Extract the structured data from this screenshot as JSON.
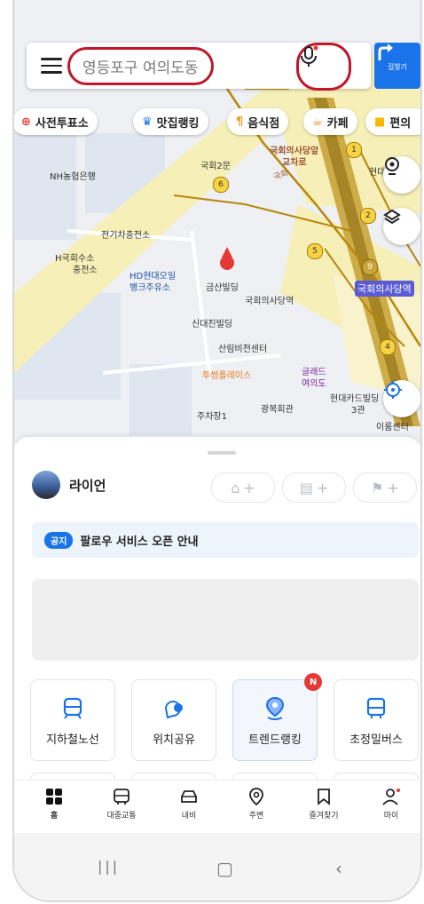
{
  "search": {
    "query": "영등포구 여의도동"
  },
  "directions_label": "길찾기",
  "chips": [
    {
      "icon": "vote-icon",
      "label": "사전투표소"
    },
    {
      "icon": "ranking-icon",
      "label": "맛집랭킹"
    },
    {
      "icon": "fork-icon",
      "label": "음식점"
    },
    {
      "icon": "cafe-icon",
      "label": "카페"
    },
    {
      "icon": "store-icon",
      "label": "편의"
    }
  ],
  "map": {
    "labels": {
      "nh_bank": "NH농협은행",
      "gukhoe_2gate": "국회2문",
      "gukhoe_junction": "국회의사당앞",
      "gyocharo": "교차로",
      "ev_station": "전기차충전소",
      "hydrogen": "H국회수소",
      "hydrogen2": "충전소",
      "hd_oilbank": "HD현대오일",
      "hd_oilbank2": "뱅크주유소",
      "geumsan": "금산빌딩",
      "gukhoe_station": "국회의사당역",
      "sindaejin": "신대진빌딩",
      "sanrim": "산림비전센터",
      "tuseom": "투썸플레이스",
      "glad": "글래드",
      "glad2": "여의도",
      "hyundai_card": "현대카드빌딩",
      "hyundai_card2": "3관",
      "parking": "주차장1",
      "gwangbok": "광복회관",
      "irum": "이룸센터",
      "hyundai": "현대",
      "station_right": "국회의사당역",
      "road_label": "국회"
    },
    "route_numbers": [
      "1",
      "6",
      "5",
      "2",
      "4",
      "9"
    ]
  },
  "profile": {
    "name": "라이언"
  },
  "shortcut_plus": "+",
  "notice": {
    "tag": "공지",
    "text": "팔로우 서비스 오픈 안내"
  },
  "tiles": [
    {
      "icon": "subway-icon",
      "label": "지하철노선"
    },
    {
      "icon": "location-share-icon",
      "label": "위치공유"
    },
    {
      "icon": "trend-icon",
      "label": "트렌드랭킹",
      "badge": "N"
    },
    {
      "icon": "bus-icon",
      "label": "초정밀버스"
    }
  ],
  "tabs": [
    {
      "icon": "home-icon",
      "label": "홈"
    },
    {
      "icon": "transit-icon",
      "label": "대중교통"
    },
    {
      "icon": "car-icon",
      "label": "내비"
    },
    {
      "icon": "pin-icon",
      "label": "주변"
    },
    {
      "icon": "bookmark-icon",
      "label": "즐겨찾기"
    },
    {
      "icon": "user-icon",
      "label": "마이"
    }
  ],
  "colors": {
    "accent": "#1a73e8",
    "highlight_ring": "#c0182a",
    "map_road": "#f6f0b8",
    "route_line": "#b8860b",
    "badge": "#e53935"
  }
}
